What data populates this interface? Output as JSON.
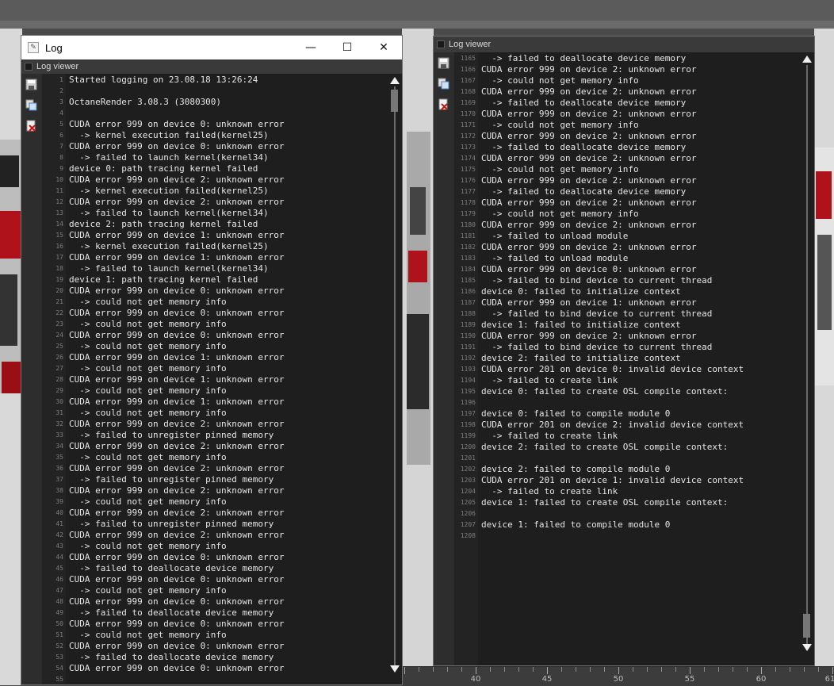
{
  "left_window": {
    "title": "Log",
    "panel_title": "Log viewer",
    "controls": {
      "minimize": "—",
      "maximize": "☐",
      "close": "✕"
    },
    "lines": [
      {
        "n": "1",
        "t": "Started logging on 23.08.18 13:26:24"
      },
      {
        "n": "2",
        "t": ""
      },
      {
        "n": "3",
        "t": "OctaneRender 3.08.3 (3080300)"
      },
      {
        "n": "4",
        "t": ""
      },
      {
        "n": "5",
        "t": "CUDA error 999 on device 0: unknown error"
      },
      {
        "n": "6",
        "t": "  -> kernel execution failed(kernel25)"
      },
      {
        "n": "7",
        "t": "CUDA error 999 on device 0: unknown error"
      },
      {
        "n": "8",
        "t": "  -> failed to launch kernel(kernel34)"
      },
      {
        "n": "9",
        "t": "device 0: path tracing kernel failed"
      },
      {
        "n": "10",
        "t": "CUDA error 999 on device 2: unknown error"
      },
      {
        "n": "11",
        "t": "  -> kernel execution failed(kernel25)"
      },
      {
        "n": "12",
        "t": "CUDA error 999 on device 2: unknown error"
      },
      {
        "n": "13",
        "t": "  -> failed to launch kernel(kernel34)"
      },
      {
        "n": "14",
        "t": "device 2: path tracing kernel failed"
      },
      {
        "n": "15",
        "t": "CUDA error 999 on device 1: unknown error"
      },
      {
        "n": "16",
        "t": "  -> kernel execution failed(kernel25)"
      },
      {
        "n": "17",
        "t": "CUDA error 999 on device 1: unknown error"
      },
      {
        "n": "18",
        "t": "  -> failed to launch kernel(kernel34)"
      },
      {
        "n": "19",
        "t": "device 1: path tracing kernel failed"
      },
      {
        "n": "20",
        "t": "CUDA error 999 on device 0: unknown error"
      },
      {
        "n": "21",
        "t": "  -> could not get memory info"
      },
      {
        "n": "22",
        "t": "CUDA error 999 on device 0: unknown error"
      },
      {
        "n": "23",
        "t": "  -> could not get memory info"
      },
      {
        "n": "24",
        "t": "CUDA error 999 on device 0: unknown error"
      },
      {
        "n": "25",
        "t": "  -> could not get memory info"
      },
      {
        "n": "26",
        "t": "CUDA error 999 on device 1: unknown error"
      },
      {
        "n": "27",
        "t": "  -> could not get memory info"
      },
      {
        "n": "28",
        "t": "CUDA error 999 on device 1: unknown error"
      },
      {
        "n": "29",
        "t": "  -> could not get memory info"
      },
      {
        "n": "30",
        "t": "CUDA error 999 on device 1: unknown error"
      },
      {
        "n": "31",
        "t": "  -> could not get memory info"
      },
      {
        "n": "32",
        "t": "CUDA error 999 on device 2: unknown error"
      },
      {
        "n": "33",
        "t": "  -> failed to unregister pinned memory"
      },
      {
        "n": "34",
        "t": "CUDA error 999 on device 2: unknown error"
      },
      {
        "n": "35",
        "t": "  -> could not get memory info"
      },
      {
        "n": "36",
        "t": "CUDA error 999 on device 2: unknown error"
      },
      {
        "n": "37",
        "t": "  -> failed to unregister pinned memory"
      },
      {
        "n": "38",
        "t": "CUDA error 999 on device 2: unknown error"
      },
      {
        "n": "39",
        "t": "  -> could not get memory info"
      },
      {
        "n": "40",
        "t": "CUDA error 999 on device 2: unknown error"
      },
      {
        "n": "41",
        "t": "  -> failed to unregister pinned memory"
      },
      {
        "n": "42",
        "t": "CUDA error 999 on device 2: unknown error"
      },
      {
        "n": "43",
        "t": "  -> could not get memory info"
      },
      {
        "n": "44",
        "t": "CUDA error 999 on device 0: unknown error"
      },
      {
        "n": "45",
        "t": "  -> failed to deallocate device memory"
      },
      {
        "n": "46",
        "t": "CUDA error 999 on device 0: unknown error"
      },
      {
        "n": "47",
        "t": "  -> could not get memory info"
      },
      {
        "n": "48",
        "t": "CUDA error 999 on device 0: unknown error"
      },
      {
        "n": "49",
        "t": "  -> failed to deallocate device memory"
      },
      {
        "n": "50",
        "t": "CUDA error 999 on device 0: unknown error"
      },
      {
        "n": "51",
        "t": "  -> could not get memory info"
      },
      {
        "n": "52",
        "t": "CUDA error 999 on device 0: unknown error"
      },
      {
        "n": "53",
        "t": "  -> failed to deallocate device memory"
      },
      {
        "n": "54",
        "t": "CUDA error 999 on device 0: unknown error"
      },
      {
        "n": "55",
        "t": ""
      }
    ]
  },
  "right_window": {
    "panel_title": "Log viewer",
    "lines": [
      {
        "n": "1165",
        "t": "  -> failed to deallocate device memory"
      },
      {
        "n": "1166",
        "t": "CUDA error 999 on device 2: unknown error"
      },
      {
        "n": "1167",
        "t": "  -> could not get memory info"
      },
      {
        "n": "1168",
        "t": "CUDA error 999 on device 2: unknown error"
      },
      {
        "n": "1169",
        "t": "  -> failed to deallocate device memory"
      },
      {
        "n": "1170",
        "t": "CUDA error 999 on device 2: unknown error"
      },
      {
        "n": "1171",
        "t": "  -> could not get memory info"
      },
      {
        "n": "1172",
        "t": "CUDA error 999 on device 2: unknown error"
      },
      {
        "n": "1173",
        "t": "  -> failed to deallocate device memory"
      },
      {
        "n": "1174",
        "t": "CUDA error 999 on device 2: unknown error"
      },
      {
        "n": "1175",
        "t": "  -> could not get memory info"
      },
      {
        "n": "1176",
        "t": "CUDA error 999 on device 2: unknown error"
      },
      {
        "n": "1177",
        "t": "  -> failed to deallocate device memory"
      },
      {
        "n": "1178",
        "t": "CUDA error 999 on device 2: unknown error"
      },
      {
        "n": "1179",
        "t": "  -> could not get memory info"
      },
      {
        "n": "1180",
        "t": "CUDA error 999 on device 2: unknown error"
      },
      {
        "n": "1181",
        "t": "  -> failed to unload module"
      },
      {
        "n": "1182",
        "t": "CUDA error 999 on device 2: unknown error"
      },
      {
        "n": "1183",
        "t": "  -> failed to unload module"
      },
      {
        "n": "1184",
        "t": "CUDA error 999 on device 0: unknown error"
      },
      {
        "n": "1185",
        "t": "  -> failed to bind device to current thread"
      },
      {
        "n": "1186",
        "t": "device 0: failed to initialize context"
      },
      {
        "n": "1187",
        "t": "CUDA error 999 on device 1: unknown error"
      },
      {
        "n": "1188",
        "t": "  -> failed to bind device to current thread"
      },
      {
        "n": "1189",
        "t": "device 1: failed to initialize context"
      },
      {
        "n": "1190",
        "t": "CUDA error 999 on device 2: unknown error"
      },
      {
        "n": "1191",
        "t": "  -> failed to bind device to current thread"
      },
      {
        "n": "1192",
        "t": "device 2: failed to initialize context"
      },
      {
        "n": "1193",
        "t": "CUDA error 201 on device 0: invalid device context"
      },
      {
        "n": "1194",
        "t": "  -> failed to create link"
      },
      {
        "n": "1195",
        "t": "device 0: failed to create OSL compile context:"
      },
      {
        "n": "1196",
        "t": ""
      },
      {
        "n": "1197",
        "t": "device 0: failed to compile module 0"
      },
      {
        "n": "1198",
        "t": "CUDA error 201 on device 2: invalid device context"
      },
      {
        "n": "1199",
        "t": "  -> failed to create link"
      },
      {
        "n": "1200",
        "t": "device 2: failed to create OSL compile context:"
      },
      {
        "n": "1201",
        "t": ""
      },
      {
        "n": "1202",
        "t": "device 2: failed to compile module 0"
      },
      {
        "n": "1203",
        "t": "CUDA error 201 on device 1: invalid device context"
      },
      {
        "n": "1204",
        "t": "  -> failed to create link"
      },
      {
        "n": "1205",
        "t": "device 1: failed to create OSL compile context:"
      },
      {
        "n": "1206",
        "t": ""
      },
      {
        "n": "1207",
        "t": "device 1: failed to compile module 0"
      },
      {
        "n": "1208",
        "t": ""
      }
    ]
  },
  "ruler": {
    "labels": [
      "40",
      "45",
      "50",
      "55",
      "60",
      "61"
    ]
  },
  "icons": [
    "save-icon",
    "copy-icon",
    "clear-icon",
    "scroll-up-icon",
    "scroll-down-icon"
  ],
  "colors": {
    "log_background": "#1e1e1e",
    "log_text": "#e6e6e6",
    "line_number": "#7d7d7d",
    "panel_header": "#3a3a3a"
  }
}
